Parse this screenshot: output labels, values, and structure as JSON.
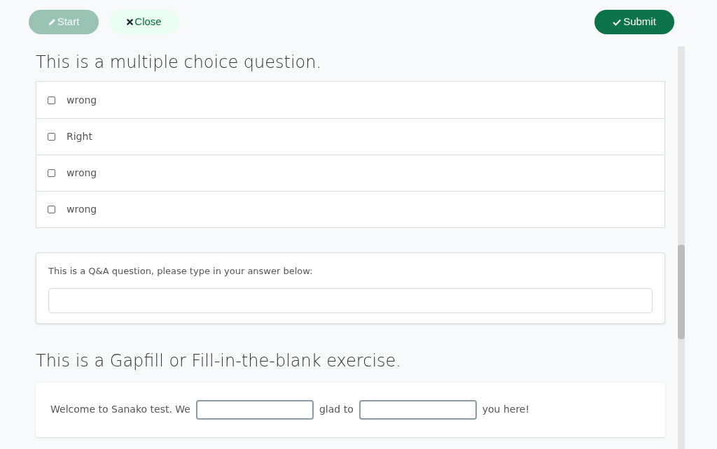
{
  "toolbar": {
    "buttons": [
      {
        "kind": "start",
        "label": "Start",
        "disabled": true
      },
      {
        "kind": "close",
        "label": "Close",
        "disabled": false
      }
    ],
    "submit": {
      "label": "Submit",
      "disabled": false
    }
  },
  "multiple_choice": {
    "title": "This is a multiple choice question.",
    "options": [
      {
        "label": "wrong",
        "checked": false
      },
      {
        "label": "Right",
        "checked": false
      },
      {
        "label": "wrong",
        "checked": false
      },
      {
        "label": "wrong",
        "checked": false
      }
    ]
  },
  "qa": {
    "prompt": "This is a Q&A question, please type in your answer below:"
  },
  "gapfill": {
    "title": "This is a Gapfill or Fill-in-the-blank exercise.",
    "segments": [
      {
        "kind": "text",
        "text": "Welcome to Sanako test. We"
      },
      {
        "kind": "blank"
      },
      {
        "kind": "text",
        "text": "glad to"
      },
      {
        "kind": "blank"
      },
      {
        "kind": "text",
        "text": "you here!"
      }
    ]
  }
}
